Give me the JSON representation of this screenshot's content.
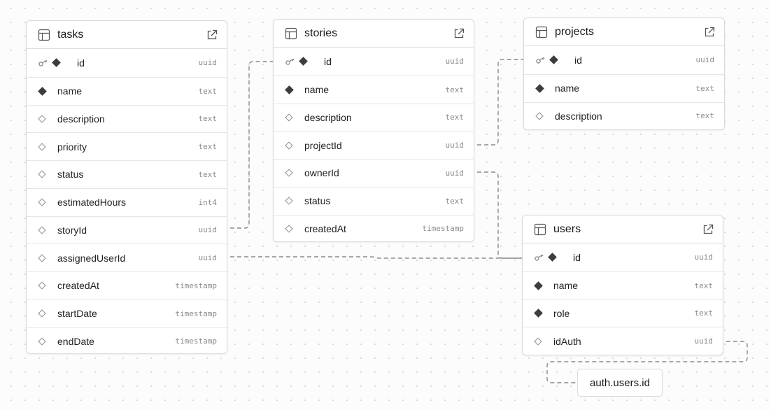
{
  "tables": {
    "tasks": {
      "name": "tasks",
      "columns": [
        {
          "name": "id",
          "type": "uuid",
          "pk": true,
          "required": true
        },
        {
          "name": "name",
          "type": "text",
          "pk": false,
          "required": true
        },
        {
          "name": "description",
          "type": "text",
          "pk": false,
          "required": false
        },
        {
          "name": "priority",
          "type": "text",
          "pk": false,
          "required": false
        },
        {
          "name": "status",
          "type": "text",
          "pk": false,
          "required": false
        },
        {
          "name": "estimatedHours",
          "type": "int4",
          "pk": false,
          "required": false
        },
        {
          "name": "storyId",
          "type": "uuid",
          "pk": false,
          "required": false
        },
        {
          "name": "assignedUserId",
          "type": "uuid",
          "pk": false,
          "required": false
        },
        {
          "name": "createdAt",
          "type": "timestamp",
          "pk": false,
          "required": false
        },
        {
          "name": "startDate",
          "type": "timestamp",
          "pk": false,
          "required": false
        },
        {
          "name": "endDate",
          "type": "timestamp",
          "pk": false,
          "required": false
        }
      ]
    },
    "stories": {
      "name": "stories",
      "columns": [
        {
          "name": "id",
          "type": "uuid",
          "pk": true,
          "required": true
        },
        {
          "name": "name",
          "type": "text",
          "pk": false,
          "required": true
        },
        {
          "name": "description",
          "type": "text",
          "pk": false,
          "required": false
        },
        {
          "name": "projectId",
          "type": "uuid",
          "pk": false,
          "required": false
        },
        {
          "name": "ownerId",
          "type": "uuid",
          "pk": false,
          "required": false
        },
        {
          "name": "status",
          "type": "text",
          "pk": false,
          "required": false
        },
        {
          "name": "createdAt",
          "type": "timestamp",
          "pk": false,
          "required": false
        }
      ]
    },
    "projects": {
      "name": "projects",
      "columns": [
        {
          "name": "id",
          "type": "uuid",
          "pk": true,
          "required": true
        },
        {
          "name": "name",
          "type": "text",
          "pk": false,
          "required": true
        },
        {
          "name": "description",
          "type": "text",
          "pk": false,
          "required": false
        }
      ]
    },
    "users": {
      "name": "users",
      "columns": [
        {
          "name": "id",
          "type": "uuid",
          "pk": true,
          "required": true
        },
        {
          "name": "name",
          "type": "text",
          "pk": false,
          "required": true
        },
        {
          "name": "role",
          "type": "text",
          "pk": false,
          "required": true
        },
        {
          "name": "idAuth",
          "type": "uuid",
          "pk": false,
          "required": false
        }
      ]
    }
  },
  "external_reference": "auth.users.id",
  "colors": {
    "edge": "#8a8a8a",
    "border": "#d9d9d9",
    "filled_marker": "#3d3d3d"
  }
}
